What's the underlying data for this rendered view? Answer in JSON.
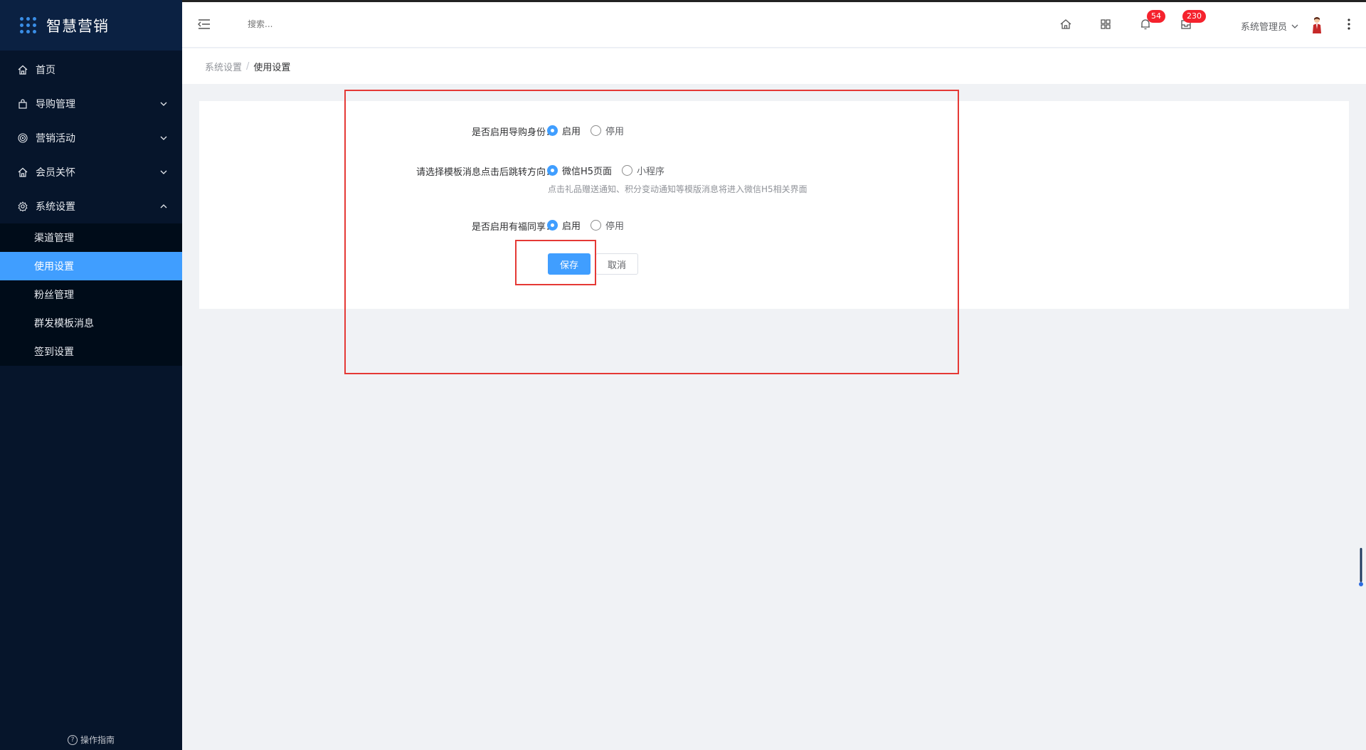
{
  "brand": {
    "name": "智慧营销"
  },
  "sidebar": {
    "items": [
      {
        "label": "首页",
        "icon": "home-icon"
      },
      {
        "label": "导购管理",
        "icon": "bag-icon"
      },
      {
        "label": "营销活动",
        "icon": "target-icon"
      },
      {
        "label": "会员关怀",
        "icon": "home-icon"
      },
      {
        "label": "系统设置",
        "icon": "gear-icon"
      }
    ],
    "sub_items": [
      {
        "label": "渠道管理",
        "active": false
      },
      {
        "label": "使用设置",
        "active": true
      },
      {
        "label": "粉丝管理",
        "active": false
      },
      {
        "label": "群发模板消息",
        "active": false
      },
      {
        "label": "签到设置",
        "active": false
      }
    ],
    "guide_label": "操作指南"
  },
  "header": {
    "search_placeholder": "搜索...",
    "notifications_badge": "54",
    "messages_badge": "230",
    "user_name": "系统管理员"
  },
  "breadcrumb": {
    "parent": "系统设置",
    "separator": "/",
    "current": "使用设置"
  },
  "form": {
    "row1": {
      "label": "是否启用导购身份：",
      "option_on": "启用",
      "option_off": "停用",
      "selected": "启用"
    },
    "row2": {
      "label": "请选择模板消息点击后跳转方向：",
      "option_a": "微信H5页面",
      "option_b": "小程序",
      "selected": "微信H5页面",
      "hint": "点击礼品赠送通知、积分变动通知等模版消息将进入微信H5相关界面"
    },
    "row3": {
      "label": "是否启用有福同享：",
      "option_on": "启用",
      "option_off": "停用",
      "selected": "启用"
    },
    "save_label": "保存",
    "cancel_label": "取消"
  },
  "colors": {
    "sidebar_bg": "#06152b",
    "accent": "#409eff",
    "badge": "#f5222d",
    "highlight_box": "#e53935"
  }
}
